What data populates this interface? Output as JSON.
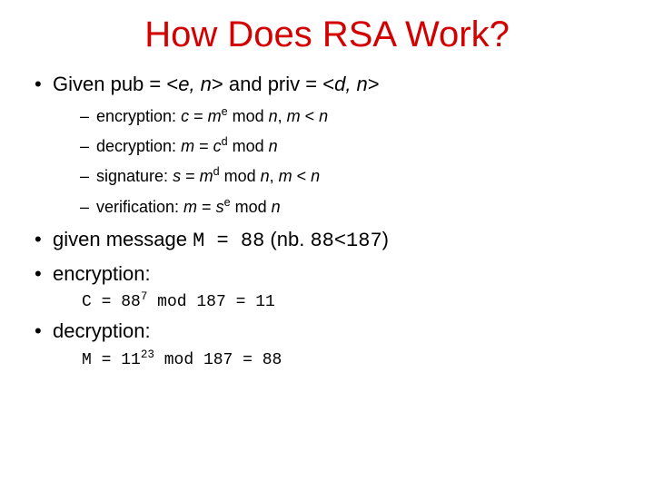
{
  "title": "How Does RSA Work?",
  "b1": {
    "lead": "Given pub = <",
    "e": "e, n",
    "mid": "> and priv = <",
    "dn": "d, n",
    "end": ">"
  },
  "enc": {
    "lead": "encryption: ",
    "c": "c",
    "eq": " = ",
    "m": "m",
    "e": "e",
    "mod": " mod ",
    "n": "n",
    "comma": ", ",
    "m2": "m",
    "lt": " < ",
    "n2": "n"
  },
  "dec": {
    "lead": "decryption: ",
    "m": "m",
    "eq": " = ",
    "c": "c",
    "d": "d",
    "mod": " mod ",
    "n": "n"
  },
  "sig": {
    "lead": "signature: ",
    "s": "s",
    "eq": " = ",
    "m": "m",
    "d": "d",
    "mod": " mod ",
    "n": "n",
    "comma": ", ",
    "m2": "m",
    "lt": " < ",
    "n2": "n"
  },
  "ver": {
    "lead": "verification: ",
    "m": "m",
    "eq": " = ",
    "s": "s",
    "e": "e",
    "mod": " mod ",
    "n": "n"
  },
  "msg": {
    "lead": "given message ",
    "mexpr": "M = 88",
    "nb_open": " (nb. ",
    "nb_val": "88<187",
    "nb_close": ")"
  },
  "enc2": {
    "label": "encryption:",
    "pre": "C = 88",
    "exp": "7",
    "post": " mod 187 = 11"
  },
  "dec2": {
    "label": "decryption:",
    "pre": "M = 11",
    "exp": "23",
    "post": " mod 187 = 88"
  }
}
